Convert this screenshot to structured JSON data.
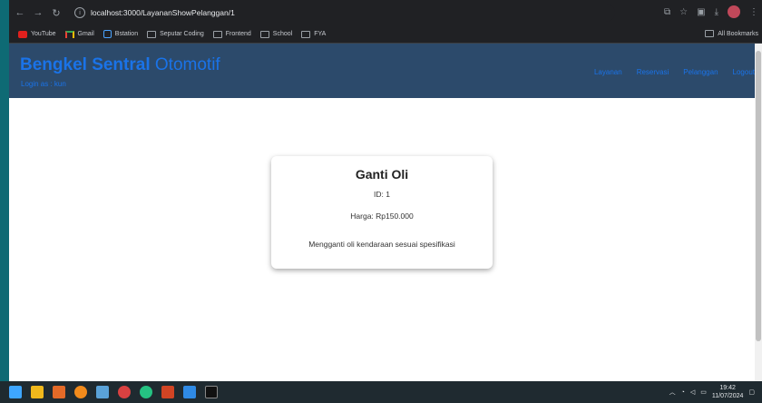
{
  "browser": {
    "url": "localhost:3000/LayananShowPelanggan/1",
    "bookmarks": [
      "YouTube",
      "Gmail",
      "Bstation",
      "Seputar Coding",
      "Frontend",
      "School",
      "FYA"
    ],
    "all_bookmarks": "All Bookmarks"
  },
  "app": {
    "brand_bold": "Bengkel Sentral",
    "brand_light": "Otomotif",
    "login_text": "Login as : kun",
    "nav": [
      "Layanan",
      "Reservasi",
      "Pelanggan",
      "Logout"
    ]
  },
  "card": {
    "title": "Ganti Oli",
    "id": "ID: 1",
    "price": "Harga: Rp150.000",
    "description": "Mengganti oli kendaraan sesuai spesifikasi"
  },
  "taskbar": {
    "time": "19:42",
    "date": "11/07/2024"
  },
  "colors": {
    "header_bg": "#2c4a6b",
    "accent": "#1a73e8"
  }
}
